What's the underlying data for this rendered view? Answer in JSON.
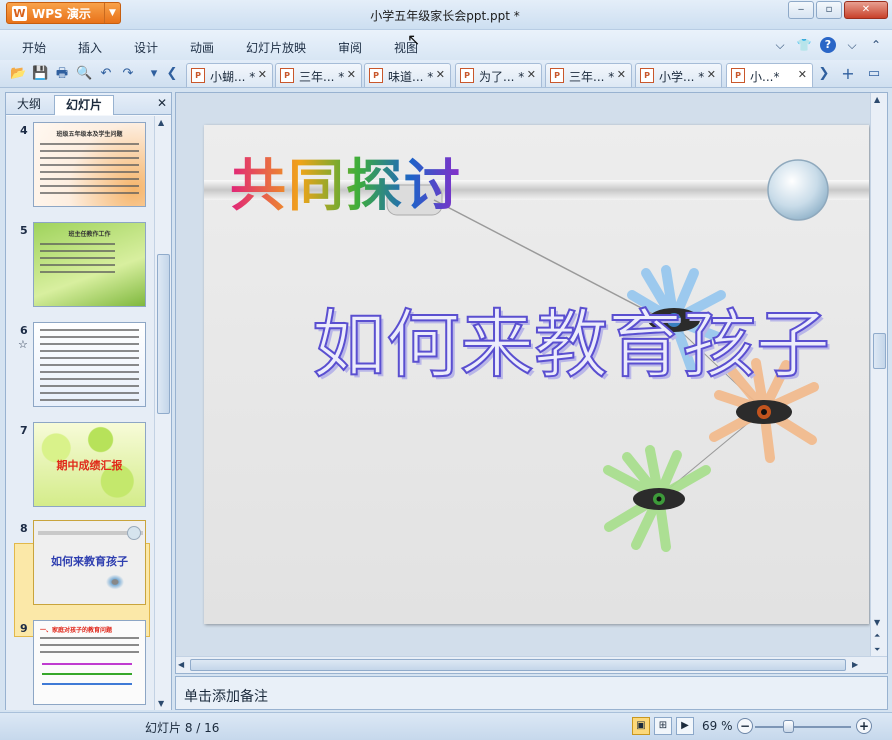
{
  "app": {
    "logo_text": "WPS 演示",
    "logo_mark": "W",
    "document_title": "小学五年级家长会ppt.ppt *"
  },
  "window_controls": {
    "minimize": "‒",
    "restore": "▫",
    "close": "✕"
  },
  "menu": {
    "items": [
      "开始",
      "插入",
      "设计",
      "动画",
      "幻灯片放映",
      "审阅",
      "视图"
    ],
    "right_icons": [
      "shirt-icon",
      "help-icon",
      "ribbon-collapse-icon"
    ],
    "right_glyphs": [
      "⌵",
      "👕",
      "?",
      "⌵",
      "⌃"
    ]
  },
  "toolbar": {
    "quick_icons": [
      "open-folder-icon",
      "save-icon",
      "print-icon",
      "print-preview-icon",
      "undo-icon",
      "redo-icon",
      "toolbar-menu-icon",
      "tab-scroll-left-icon"
    ],
    "quick_glyphs": [
      "📂",
      "💾",
      "🖶",
      "🔍",
      "↶",
      "↷",
      "▾",
      "❮"
    ],
    "tab_scroll_right": "❯",
    "new_tab": "+",
    "tabs": [
      {
        "label": "小蝴... *",
        "active": false
      },
      {
        "label": "三年... *",
        "active": false
      },
      {
        "label": "味道... *",
        "active": false
      },
      {
        "label": "为了... *",
        "active": false
      },
      {
        "label": "三年... *",
        "active": false
      },
      {
        "label": "小学... *",
        "active": false
      },
      {
        "label": "小...*",
        "active": true
      }
    ],
    "tab_close": "✕",
    "tab_file_glyph": "P"
  },
  "side_panel": {
    "tabs": [
      "大纲",
      "幻灯片"
    ],
    "active_tab": "幻灯片",
    "close": "✕",
    "thumbnails": [
      {
        "number": "4",
        "title": "班级五年级本及学生问题"
      },
      {
        "number": "5",
        "title": "班主任教作工作"
      },
      {
        "number": "6",
        "title": "",
        "extra": "☆"
      },
      {
        "number": "7",
        "title": "期中成绩汇报"
      },
      {
        "number": "8",
        "title": "如何来教育孩子",
        "selected": true
      },
      {
        "number": "9",
        "title": "一、家庭对孩子的教育问题"
      }
    ]
  },
  "slide": {
    "title": "共同探讨",
    "subtitle": "如何来教育孩子",
    "colors": {
      "title_gradient": [
        "#e0237a",
        "#f0a31a",
        "#3fae3a",
        "#1e63c8",
        "#8a2cc9"
      ],
      "subtitle_stroke": "#5a4fd0"
    }
  },
  "notes": {
    "placeholder": "单击添加备注"
  },
  "status": {
    "slide_counter": "幻灯片 8 / 16",
    "zoom": "69 %",
    "zoom_level": 0.35
  },
  "view_buttons": [
    "normal-view-icon",
    "slide-sorter-icon",
    "slideshow-icon"
  ]
}
